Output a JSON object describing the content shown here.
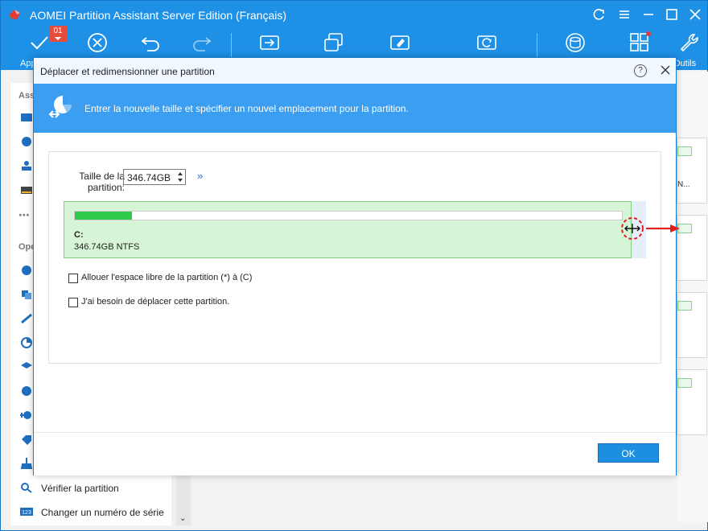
{
  "app": {
    "title": "AOMEI Partition Assistant Server Edition (Français)",
    "toolbar": {
      "apply_label": "App",
      "pending_count": "01",
      "tools_label": "Outils"
    }
  },
  "left_panel": {
    "section_1": "Ass",
    "section_2": "Ope",
    "items": [
      {
        "label": "Vérifier la partition"
      },
      {
        "label": "Changer un numéro de série"
      }
    ]
  },
  "right_panel": {
    "fragment": "N..."
  },
  "dialog": {
    "title": "Déplacer et redimensionner une partition",
    "help": "?",
    "banner_text": "Entrer la nouvelle taille et spécifier un nouvel emplacement pour la partition.",
    "size_label": "Taille de la partition:",
    "size_value": "346.74GB",
    "expand_symbol": "»",
    "partition": {
      "letter": "C:",
      "info": "346.74GB NTFS",
      "used_fraction": 0.105
    },
    "checkbox_1": "Allouer l'espace libre de la partition (*) à (C)",
    "checkbox_2": "J'ai besoin de déplacer cette partition.",
    "ok_label": "OK"
  },
  "colors": {
    "brand_blue": "#1e90e6",
    "banner_blue": "#3b9ef0",
    "partition_green": "#d6f5d6",
    "used_green": "#2ecb4a",
    "accent_red": "#e02020"
  }
}
